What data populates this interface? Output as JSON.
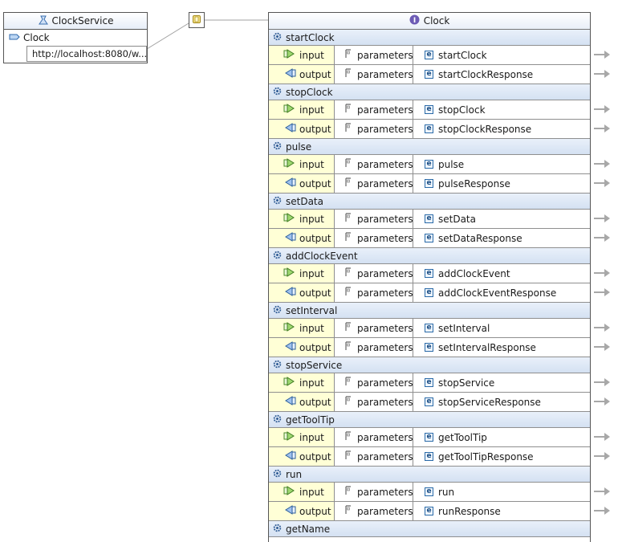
{
  "service": {
    "name": "ClockService",
    "port_name": "Clock",
    "address": "http://localhost:8080/w..."
  },
  "porttype": {
    "name": "Clock"
  },
  "labels": {
    "input": "input",
    "output": "output",
    "parameters": "parameters"
  },
  "operations": [
    {
      "name": "startClock",
      "input": "startClock",
      "output": "startClockResponse"
    },
    {
      "name": "stopClock",
      "input": "stopClock",
      "output": "stopClockResponse"
    },
    {
      "name": "pulse",
      "input": "pulse",
      "output": "pulseResponse"
    },
    {
      "name": "setData",
      "input": "setData",
      "output": "setDataResponse"
    },
    {
      "name": "addClockEvent",
      "input": "addClockEvent",
      "output": "addClockEventResponse"
    },
    {
      "name": "setInterval",
      "input": "setInterval",
      "output": "setIntervalResponse"
    },
    {
      "name": "stopService",
      "input": "stopService",
      "output": "stopServiceResponse"
    },
    {
      "name": "getToolTip",
      "input": "getToolTip",
      "output": "getToolTipResponse"
    },
    {
      "name": "run",
      "input": "run",
      "output": "runResponse"
    },
    {
      "name": "getName"
    }
  ]
}
